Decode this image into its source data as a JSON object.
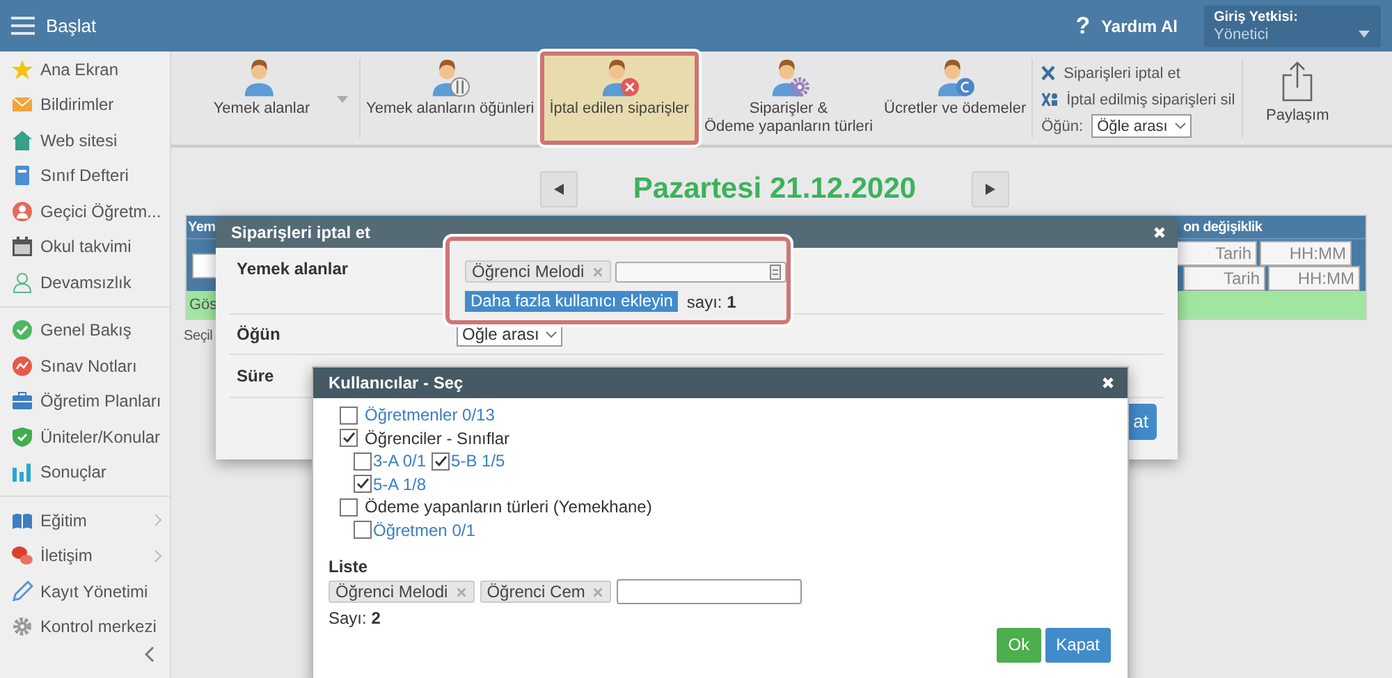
{
  "topbar": {
    "title": "Başlat",
    "help_icon": "?",
    "help": "Yardım Al",
    "role_label": "Giriş Yetkisi:",
    "role": "Yönetici"
  },
  "sidebar": {
    "sections": [
      {
        "items": [
          {
            "label": "Ana Ekran",
            "has_submenu": false
          },
          {
            "label": "Bildirimler",
            "has_submenu": false
          },
          {
            "label": "Web sitesi",
            "has_submenu": false
          },
          {
            "label": "Sınıf Defteri",
            "has_submenu": false
          },
          {
            "label": "Geçici Öğretm...",
            "has_submenu": false
          },
          {
            "label": "Okul takvimi",
            "has_submenu": false
          },
          {
            "label": "Devamsızlık",
            "has_submenu": false
          }
        ]
      },
      {
        "items": [
          {
            "label": "Genel Bakış",
            "has_submenu": false
          },
          {
            "label": "Sınav Notları",
            "has_submenu": false
          },
          {
            "label": "Öğretim Planları",
            "has_submenu": false
          },
          {
            "label": "Üniteler/Konular",
            "has_submenu": false
          },
          {
            "label": "Sonuçlar",
            "has_submenu": false
          }
        ]
      },
      {
        "items": [
          {
            "label": "Eğitim",
            "has_submenu": true
          },
          {
            "label": "İletişim",
            "has_submenu": true
          },
          {
            "label": "Kayıt Yönetimi",
            "has_submenu": false
          },
          {
            "label": "Kontrol merkezi",
            "has_submenu": false
          }
        ]
      }
    ]
  },
  "toolbar": {
    "buttons": [
      {
        "label": "Yemek alanlar",
        "dropdown": true,
        "selected": false
      },
      {
        "label": "Yemek alanların öğünleri",
        "dropdown": false,
        "selected": false
      },
      {
        "label": "İptal edilen siparişler",
        "dropdown": false,
        "selected": true
      },
      {
        "label": "Siparişler &\nÖdeme yapanların türleri",
        "dropdown": false,
        "selected": false
      },
      {
        "label": "Ücretler ve ödemeler",
        "dropdown": false,
        "selected": false
      }
    ],
    "actions": [
      "Siparişleri iptal et",
      "İptal edilmiş siparişleri sil"
    ],
    "meal_label": "Öğün:",
    "meal_value": "Öğle arası",
    "share": "Paylaşım"
  },
  "date_nav": {
    "date": "Pazartesi 21.12.2020"
  },
  "background_table": {
    "header_left": "Yem",
    "header_right": "on değişiklik",
    "rows": [
      {
        "date_placeholder": "Tarih",
        "time_placeholder": "HH:MM"
      },
      {
        "date_placeholder": "Tarih",
        "time_placeholder": "HH:MM"
      }
    ],
    "footer": "Gös",
    "note": "Seçil"
  },
  "cancel_dialog": {
    "title": "Siparişleri iptal et",
    "users_label": "Yemek alanlar",
    "chips": [
      "Öğrenci Melodi"
    ],
    "add_button": "Daha fazla kullanıcı ekleyin",
    "count": "sayı: **1**",
    "meal_label": "Öğün",
    "meal_value": "Öğle arası",
    "duration_label": "Süre",
    "cut_button": "at"
  },
  "users_dialog": {
    "title": "Kullanıcılar - Seç",
    "tree": [
      {
        "label": "Öğretmenler 0/13",
        "kind": "link",
        "checked": false
      },
      {
        "label": "Öğrenciler - Sınıflar",
        "kind": "group",
        "checked": true,
        "children": [
          {
            "label": "3-A 0/1",
            "kind": "link",
            "checked": false
          },
          {
            "label": "5-B 1/5",
            "kind": "link",
            "checked": true
          },
          {
            "label": "5-A 1/8",
            "kind": "link",
            "checked": true
          }
        ]
      },
      {
        "label": "Ödeme yapanların türleri (Yemekhane)",
        "kind": "group",
        "checked": false,
        "children": [
          {
            "label": "Öğretmen 0/1",
            "kind": "link",
            "checked": false
          }
        ]
      }
    ],
    "list_label": "Liste",
    "chips": [
      "Öğrenci Melodi",
      "Öğrenci Cem"
    ],
    "count": "Sayı: **2**",
    "buttons": [
      {
        "label": "Ok",
        "kind": "success"
      },
      {
        "label": "Kapat",
        "kind": "primary"
      }
    ]
  }
}
